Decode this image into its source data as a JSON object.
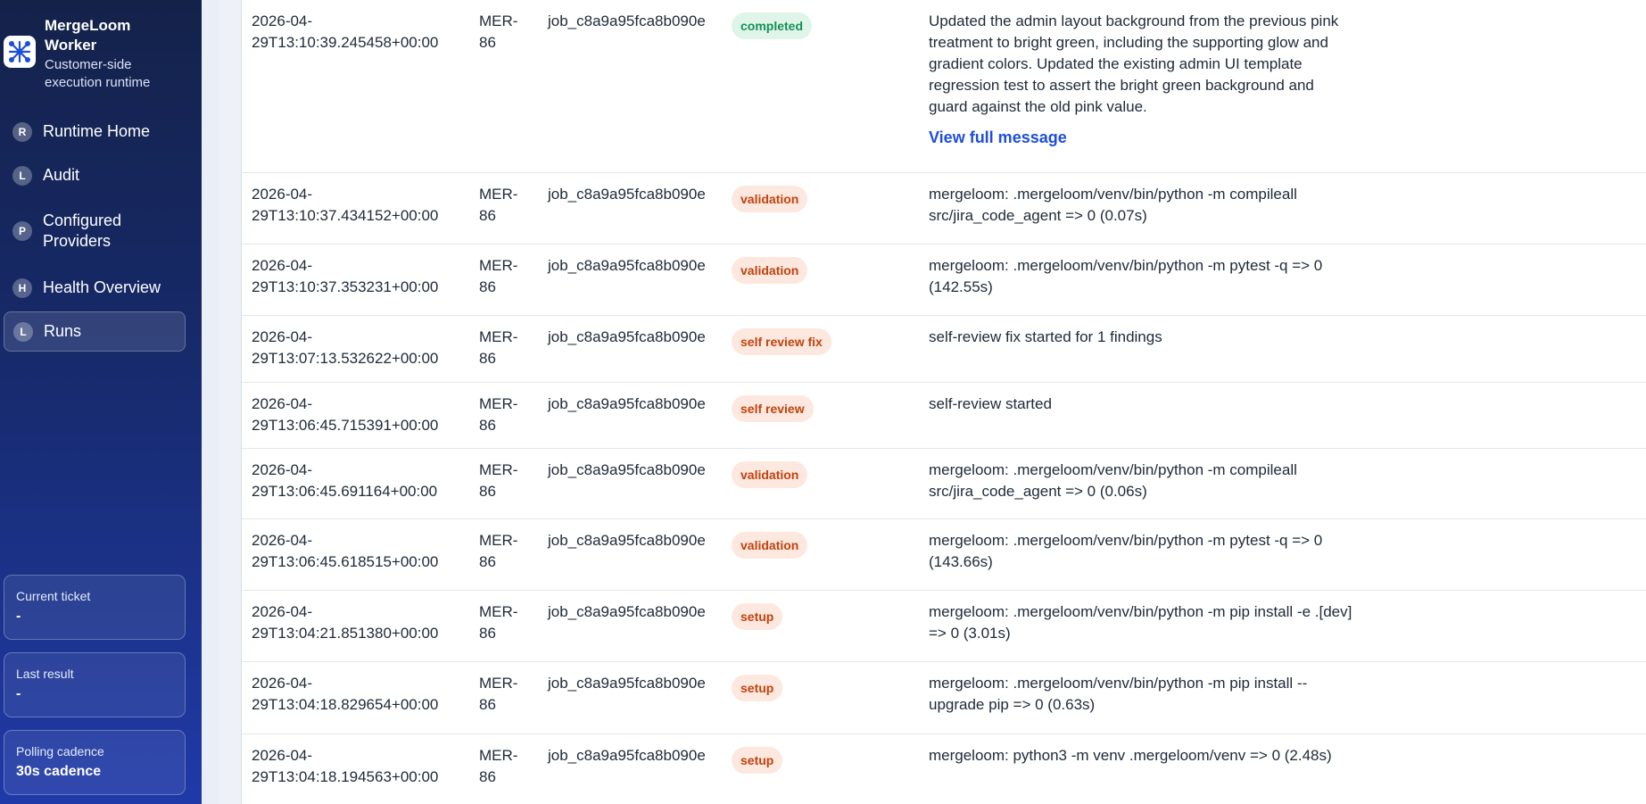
{
  "brand": {
    "title": "MergeLoom Worker",
    "subtitle": "Customer-side execution runtime",
    "logo_icon": "network-icon",
    "logo_color": "#1d4ed8"
  },
  "nav": [
    {
      "badge": "R",
      "label": "Runtime Home",
      "active": false
    },
    {
      "badge": "L",
      "label": "Audit",
      "active": false
    },
    {
      "badge": "P",
      "label": "Configured Providers",
      "active": false
    },
    {
      "badge": "H",
      "label": "Health Overview",
      "active": false
    },
    {
      "badge": "L",
      "label": "Runs",
      "active": true
    }
  ],
  "status_cards": {
    "current_ticket": {
      "label": "Current ticket",
      "value": "-"
    },
    "last_result": {
      "label": "Last result",
      "value": "-"
    },
    "polling": {
      "label": "Polling cadence",
      "value": "30s cadence"
    }
  },
  "events": [
    {
      "time": "2026-04-29T13:10:39.245458+00:00",
      "ticket": "MER-86",
      "job": "job_c8a9a95fca8b090e",
      "stage": "completed",
      "stage_kind": "completed",
      "message": "Updated the admin layout background from the previous pink treatment to bright green, including the supporting glow and gradient colors. Updated the existing admin UI template regression test to assert the bright green background and guard against the old pink value.",
      "link": "View full message"
    },
    {
      "time": "2026-04-29T13:10:37.434152+00:00",
      "ticket": "MER-86",
      "job": "job_c8a9a95fca8b090e",
      "stage": "validation",
      "stage_kind": "warn",
      "message": "mergeloom: .mergeloom/venv/bin/python -m compileall src/jira_code_agent => 0 (0.07s)"
    },
    {
      "time": "2026-04-29T13:10:37.353231+00:00",
      "ticket": "MER-86",
      "job": "job_c8a9a95fca8b090e",
      "stage": "validation",
      "stage_kind": "warn",
      "message": "mergeloom: .mergeloom/venv/bin/python -m pytest -q => 0 (142.55s)"
    },
    {
      "time": "2026-04-29T13:07:13.532622+00:00",
      "ticket": "MER-86",
      "job": "job_c8a9a95fca8b090e",
      "stage": "self review fix",
      "stage_kind": "warn",
      "message": "self-review fix started for 1 findings"
    },
    {
      "time": "2026-04-29T13:06:45.715391+00:00",
      "ticket": "MER-86",
      "job": "job_c8a9a95fca8b090e",
      "stage": "self review",
      "stage_kind": "warn",
      "message": "self-review started"
    },
    {
      "time": "2026-04-29T13:06:45.691164+00:00",
      "ticket": "MER-86",
      "job": "job_c8a9a95fca8b090e",
      "stage": "validation",
      "stage_kind": "warn",
      "message": "mergeloom: .mergeloom/venv/bin/python -m compileall src/jira_code_agent => 0 (0.06s)"
    },
    {
      "time": "2026-04-29T13:06:45.618515+00:00",
      "ticket": "MER-86",
      "job": "job_c8a9a95fca8b090e",
      "stage": "validation",
      "stage_kind": "warn",
      "message": "mergeloom: .mergeloom/venv/bin/python -m pytest -q => 0 (143.66s)"
    },
    {
      "time": "2026-04-29T13:04:21.851380+00:00",
      "ticket": "MER-86",
      "job": "job_c8a9a95fca8b090e",
      "stage": "setup",
      "stage_kind": "warn",
      "message": "mergeloom: .mergeloom/venv/bin/python -m pip install -e .[dev] => 0 (3.01s)"
    },
    {
      "time": "2026-04-29T13:04:18.829654+00:00",
      "ticket": "MER-86",
      "job": "job_c8a9a95fca8b090e",
      "stage": "setup",
      "stage_kind": "warn",
      "message": "mergeloom: .mergeloom/venv/bin/python -m pip install --upgrade pip => 0 (0.63s)"
    },
    {
      "time": "2026-04-29T13:04:18.194563+00:00",
      "ticket": "MER-86",
      "job": "job_c8a9a95fca8b090e",
      "stage": "setup",
      "stage_kind": "warn",
      "message": "mergeloom: python3 -m venv .mergeloom/venv => 0 (2.48s)"
    }
  ]
}
